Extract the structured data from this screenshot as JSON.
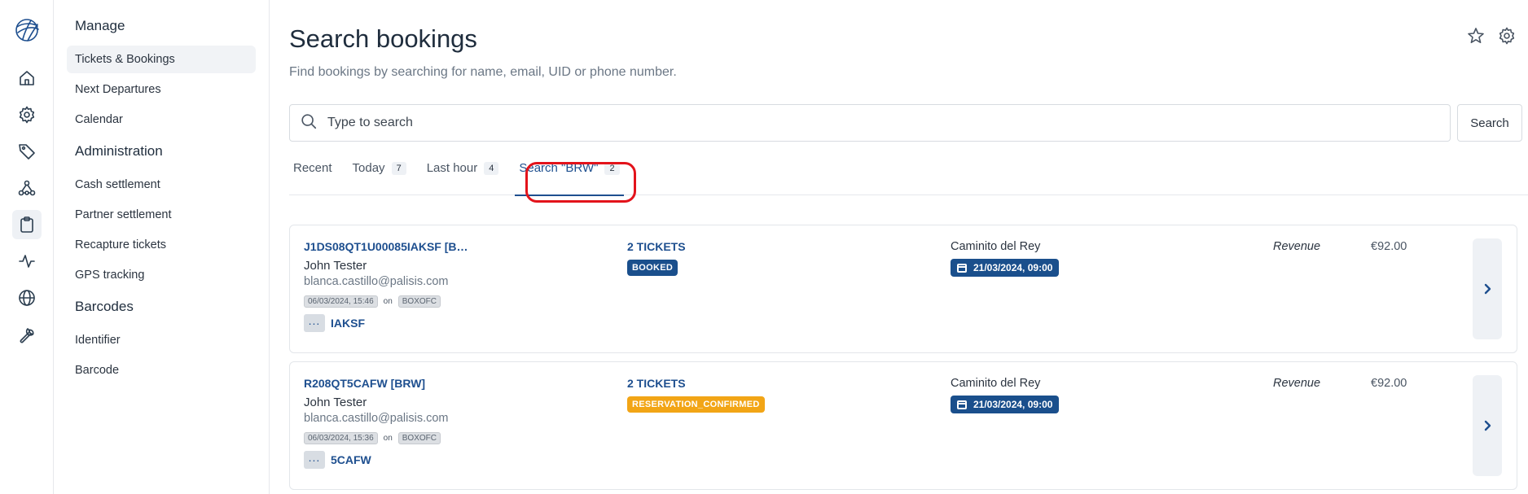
{
  "rail": {
    "items": [
      {
        "icon": "home-icon"
      },
      {
        "icon": "gear-icon"
      },
      {
        "icon": "tag-icon"
      },
      {
        "icon": "network-icon"
      },
      {
        "icon": "clipboard-icon",
        "active": true
      },
      {
        "icon": "activity-icon"
      },
      {
        "icon": "globe-icon"
      },
      {
        "icon": "wrench-icon"
      }
    ]
  },
  "sidebar": {
    "section_manage": "Manage",
    "manage_items": [
      "Tickets & Bookings",
      "Next Departures",
      "Calendar"
    ],
    "section_admin": "Administration",
    "admin_items": [
      "Cash settlement",
      "Partner settlement",
      "Recapture tickets",
      "GPS tracking"
    ],
    "section_barcodes": "Barcodes",
    "barcode_items": [
      "Identifier",
      "Barcode"
    ]
  },
  "page": {
    "title": "Search bookings",
    "subtitle": "Find bookings by searching for name, email, UID or phone number."
  },
  "search": {
    "placeholder": "Type to search",
    "value": "",
    "button": "Search"
  },
  "tabs": [
    {
      "label": "Recent",
      "count": ""
    },
    {
      "label": "Today",
      "count": "7"
    },
    {
      "label": "Last hour",
      "count": "4"
    },
    {
      "label": "Search \"BRW\"",
      "count": "2",
      "active": true
    }
  ],
  "bookings": [
    {
      "uid": "J1DS08QT1U00085IAKSF [B…",
      "name": "John Tester",
      "email": "blanca.castillo@palisis.com",
      "created": "06/03/2024, 15:46",
      "on": "on",
      "channel": "BOXOFC",
      "code": "IAKSF",
      "tickets": "2 TICKETS",
      "status": "BOOKED",
      "product": "Caminito del Rey",
      "date": "21/03/2024, 09:00",
      "revenue_label": "Revenue",
      "revenue": "€92.00"
    },
    {
      "uid": "R208QT5CAFW [BRW]",
      "name": "John Tester",
      "email": "blanca.castillo@palisis.com",
      "created": "06/03/2024, 15:36",
      "on": "on",
      "channel": "BOXOFC",
      "code": "5CAFW",
      "tickets": "2 TICKETS",
      "status": "RESERVATION_CONFIRMED",
      "product": "Caminito del Rey",
      "date": "21/03/2024, 09:00",
      "revenue_label": "Revenue",
      "revenue": "€92.00"
    }
  ],
  "colors": {
    "accent": "#1e4f8f",
    "status_booked": "#1a4f8c",
    "status_reservation": "#f2a516",
    "highlight": "#e3131b"
  }
}
